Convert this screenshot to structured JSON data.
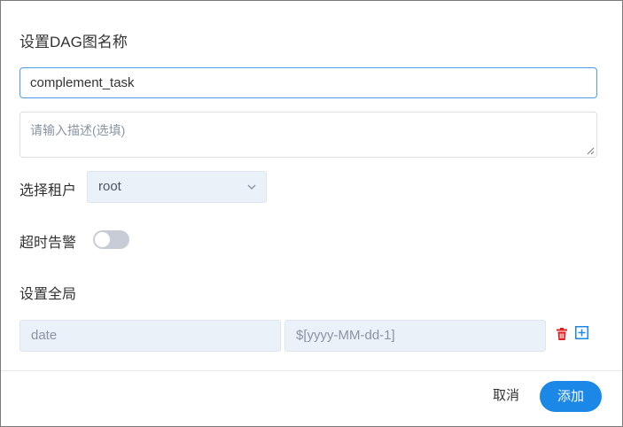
{
  "form": {
    "title": "设置DAG图名称",
    "name_value": "complement_task",
    "description_placeholder": "请输入描述(选填)",
    "tenant_label": "选择租户",
    "tenant_value": "root",
    "timeout_label": "超时告警",
    "timeout_enabled": false,
    "global_label": "设置全局",
    "global_params": [
      {
        "key": "date",
        "value": "$[yyyy-MM-dd-1]"
      }
    ]
  },
  "footer": {
    "cancel_label": "取消",
    "add_label": "添加"
  },
  "colors": {
    "primary": "#1b87e6",
    "delete_icon": "#e02020",
    "field_bg": "#ebf1f9",
    "toggle_off": "#c7ccd6"
  },
  "icons": {
    "dropdown": "chevron-down-icon",
    "delete": "trash-icon",
    "add": "plus-square-icon",
    "resize": "resize-grip-icon"
  }
}
